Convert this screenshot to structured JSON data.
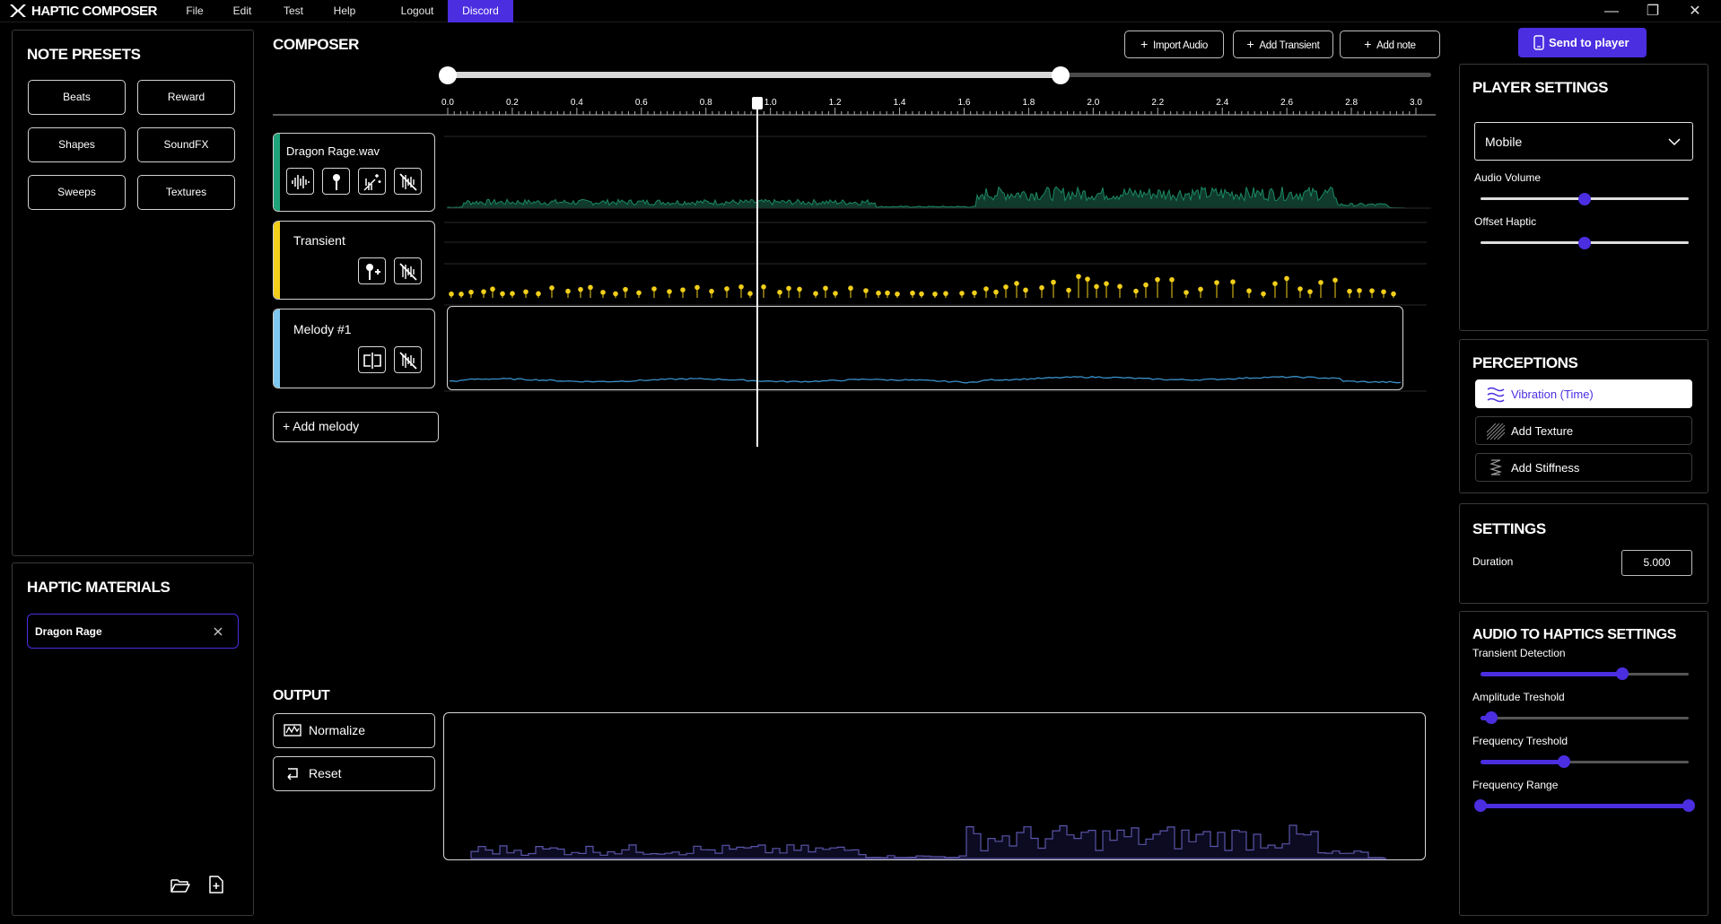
{
  "app": {
    "title": "HAPTIC COMPOSER"
  },
  "menu": {
    "file": "File",
    "edit": "Edit",
    "test": "Test",
    "help": "Help",
    "logout": "Logout",
    "discord": "Discord"
  },
  "window_controls": {
    "minimize": "—",
    "restore": "❐",
    "close": "✕"
  },
  "note_presets": {
    "title": "NOTE PRESETS",
    "items": [
      "Beats",
      "Reward",
      "Shapes",
      "SoundFX",
      "Sweeps",
      "Textures"
    ]
  },
  "haptic_materials": {
    "title": "HAPTIC MATERIALS",
    "selected": "Dragon Rage"
  },
  "composer": {
    "title": "COMPOSER",
    "import_audio": "Import Audio",
    "add_transient": "Add Transient",
    "add_note": "Add note",
    "range_start": 0.0,
    "range_end": 1.9,
    "playhead": 0.96,
    "ruler_ticks": [
      "0.0",
      "0.2",
      "0.4",
      "0.6",
      "0.8",
      "1.0",
      "1.2",
      "1.4",
      "1.6",
      "1.8",
      "2.0",
      "2.2",
      "2.4",
      "2.6",
      "2.8",
      "3.0"
    ],
    "tracks": {
      "audio": "Dragon Rage.wav",
      "transient": "Transient",
      "melody": "Melody #1"
    },
    "add_melody": "Add melody"
  },
  "output": {
    "title": "OUTPUT",
    "normalize": "Normalize",
    "reset": "Reset"
  },
  "send_to_player": "Send to player",
  "player_settings": {
    "title": "PLAYER SETTINGS",
    "device": "Mobile",
    "audio_volume_label": "Audio Volume",
    "audio_volume": 0.5,
    "offset_haptic_label": "Offset Haptic",
    "offset_haptic": 0.5
  },
  "perceptions": {
    "title": "PERCEPTIONS",
    "items": [
      "Vibration (Time)",
      "Add Texture",
      "Add Stiffness"
    ]
  },
  "settings": {
    "title": "SETTINGS",
    "duration_label": "Duration",
    "duration": "5.000"
  },
  "audio_to_haptics": {
    "title": "AUDIO TO HAPTICS SETTINGS",
    "transient_detection_label": "Transient Detection",
    "transient_detection": 0.68,
    "amplitude_threshold_label": "Amplitude Treshold",
    "amplitude_threshold": 0.05,
    "frequency_threshold_label": "Frequency Treshold",
    "frequency_threshold": 0.4,
    "frequency_range_label": "Frequency Range",
    "frequency_range": [
      0.0,
      1.0
    ]
  },
  "colors": {
    "accent": "#4b2ee0",
    "audio_track": "#1fa37a",
    "transient_track": "#f2cf1a",
    "melody_track": "#7ec8f0",
    "waveform": "#1b8a62",
    "output_wave": "#5a55a8"
  }
}
